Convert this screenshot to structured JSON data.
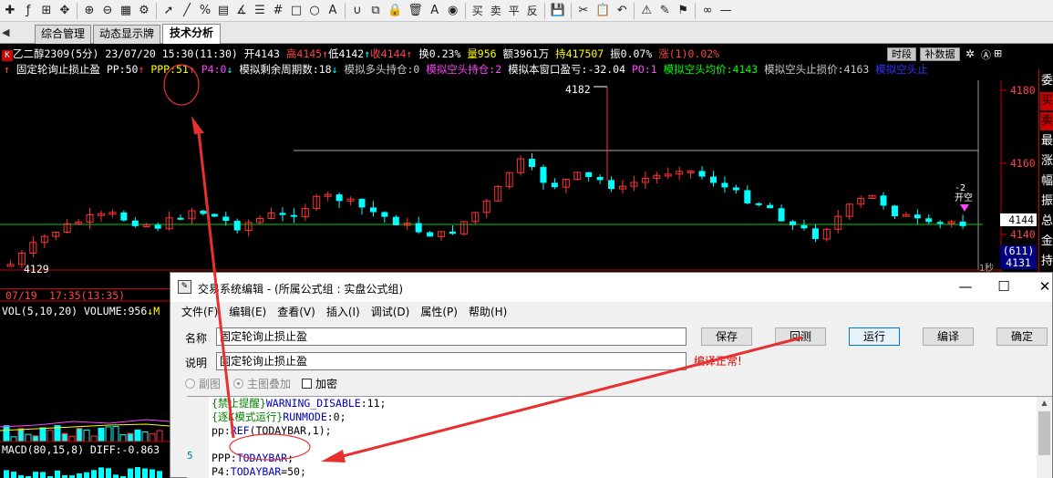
{
  "toolbar": {
    "buttons": [
      {
        "name": "cross-icon",
        "glyph": "✚"
      },
      {
        "name": "function-icon",
        "glyph": "ƒ"
      },
      {
        "name": "crosshair-icon",
        "glyph": "⊞"
      },
      {
        "name": "move-icon",
        "glyph": "✥"
      },
      {
        "name": "zoom-in-icon",
        "glyph": "⊕"
      },
      {
        "name": "zoom-out-icon",
        "glyph": "⊖"
      },
      {
        "name": "table-icon",
        "glyph": "▦"
      },
      {
        "name": "settings-icon",
        "glyph": "⚙"
      },
      {
        "name": "cursor-icon",
        "glyph": "➚"
      },
      {
        "name": "line-icon",
        "glyph": "╱"
      },
      {
        "name": "percent-icon",
        "glyph": "%"
      },
      {
        "name": "ruler-icon",
        "glyph": "▤"
      },
      {
        "name": "angle-icon",
        "glyph": "∡"
      },
      {
        "name": "fibonacci-icon",
        "glyph": "☰"
      },
      {
        "name": "grid-icon",
        "glyph": "#"
      },
      {
        "name": "rectangle-icon",
        "glyph": "□"
      },
      {
        "name": "circle-icon",
        "glyph": "○"
      },
      {
        "name": "text-icon",
        "glyph": "A"
      },
      {
        "name": "magnet-icon",
        "glyph": "∪"
      },
      {
        "name": "copy-icon",
        "glyph": "⧉"
      },
      {
        "name": "lock-icon",
        "glyph": "🔒"
      },
      {
        "name": "delete-icon",
        "glyph": "🗑"
      },
      {
        "name": "color-icon",
        "glyph": "A"
      },
      {
        "name": "hide-icon",
        "glyph": "◉"
      }
    ],
    "text_buttons": [
      "买",
      "卖",
      "平",
      "反"
    ],
    "right_buttons": [
      {
        "name": "save-icon",
        "glyph": "💾"
      },
      {
        "name": "cut-icon",
        "glyph": "✂"
      },
      {
        "name": "paste-icon",
        "glyph": "📋"
      },
      {
        "name": "undo-icon",
        "glyph": "↶"
      },
      {
        "name": "alert-icon",
        "glyph": "⚠"
      },
      {
        "name": "alert-edit-icon",
        "glyph": "✎"
      },
      {
        "name": "alert-list-icon",
        "glyph": "⚑"
      },
      {
        "name": "binocular-icon",
        "glyph": "∞"
      },
      {
        "name": "minimize-icon",
        "glyph": "—"
      }
    ]
  },
  "tabs": [
    {
      "label": "综合管理",
      "active": false
    },
    {
      "label": "动态显示牌",
      "active": false
    },
    {
      "label": "技术分析",
      "active": true
    }
  ],
  "chart": {
    "info_line": {
      "icon": "K",
      "name": "乙二醇2309(5分)",
      "datetime": "23/07/20 15:30(11:30)",
      "open": "开4143",
      "high": "高4145",
      "low": "低4142",
      "close": "收4144",
      "turnover": "换0.23%",
      "volume": "量956",
      "amount": "额3961万",
      "position": "持417507",
      "amplitude": "振0.07%",
      "change": "涨(1)0.02%",
      "btn_timeshare": "时段",
      "btn_supplement": "补数据"
    },
    "indicator_line": {
      "title": "固定轮询止损止盈",
      "pp": "PP:50",
      "ppp": "PPP:51",
      "p4": "P4:0",
      "remain": "模拟剩余周期数:18",
      "long_pos": "模拟多头持仓:0",
      "short_pos": "模拟空头持仓:2",
      "pnl": "模拟本窗口盈亏:-32.04",
      "po": "PO:1",
      "short_avg": "模拟空头均价:4143",
      "short_stop": "模拟空头止损价:4163",
      "short_stop2": "模拟空头止"
    },
    "price_labels": [
      "4180",
      "4160",
      "4140"
    ],
    "current_price": "4144",
    "side_info_1": "(611)",
    "side_info_2": "4131",
    "peak_label": "4182",
    "low_label": "4129",
    "open_signal": "开空",
    "open_signal_num": "-2",
    "one_sec": "1秒",
    "right_panel": [
      "委",
      "买",
      "卖",
      "最",
      "涨",
      "幅",
      "振",
      "总",
      "金",
      "持"
    ],
    "sub_date": "07/19",
    "sub_time": "17:35(13:35)",
    "vol_line": "VOL(5,10,20) VOLUME:956",
    "vol_ma": "M",
    "macd_line": "MACD(80,15,8) DIFF:-0.863"
  },
  "dialog": {
    "title": "交易系统编辑 - (所属公式组 : 实盘公式组)",
    "menu": [
      "文件(F)",
      "编辑(E)",
      "查看(V)",
      "插入(I)",
      "调试(D)",
      "属性(P)",
      "帮助(H)"
    ],
    "name_label": "名称",
    "name_value": "固定轮询止损止盈",
    "desc_label": "说明",
    "desc_value": "固定轮询止损止盈",
    "radio_sub": "副图",
    "radio_main": "主图叠加",
    "check_encrypt": "加密",
    "status": "编译正常!",
    "buttons": [
      "保存",
      "回测",
      "运行",
      "编译",
      "确定"
    ],
    "gutter_line": "5",
    "code": [
      {
        "p1": "{禁止提醒}",
        "p2": "WARNING_DISABLE",
        "p3": ":11;"
      },
      {
        "p1": "{逐K模式运行}",
        "p2": "RUNMODE",
        "p3": ":0;"
      },
      {
        "p1": "pp:",
        "p2": "REF",
        "p3": "(TODAYBAR,1);"
      },
      {
        "p1": "",
        "p2": "",
        "p3": ""
      },
      {
        "p1": "PPP:",
        "p2": "TODAYBAR",
        "p3": ";"
      },
      {
        "p1": "P4:",
        "p2": "TODAYBAR",
        "p3": "=50;"
      }
    ]
  },
  "colors": {
    "up": "#ff3333",
    "down": "#00ffff",
    "annotation": "#ff3333",
    "ma": "#00cc00"
  }
}
